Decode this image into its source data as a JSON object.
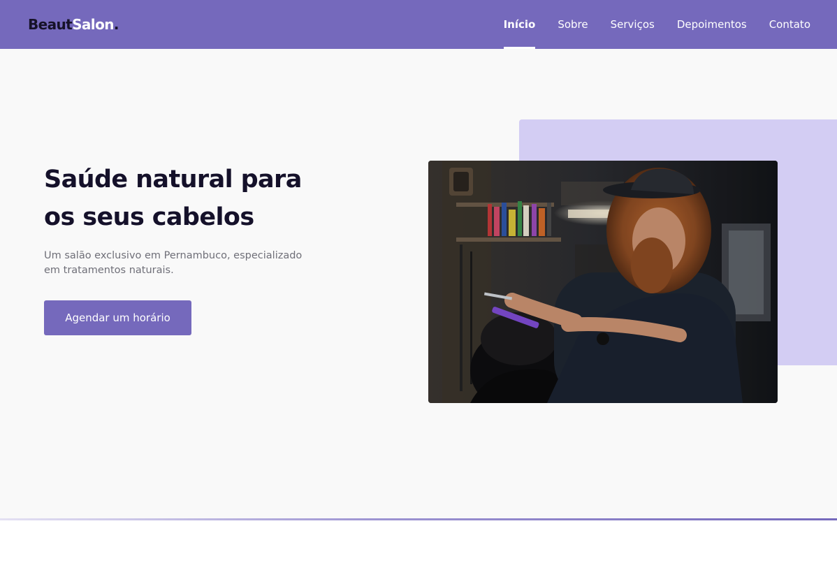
{
  "brand": {
    "logo_part1": "Beaut",
    "logo_part2": "Salon",
    "logo_part3": "."
  },
  "nav": {
    "items": [
      {
        "label": "Início",
        "active": true
      },
      {
        "label": "Sobre",
        "active": false
      },
      {
        "label": "Serviços",
        "active": false
      },
      {
        "label": "Depoimentos",
        "active": false
      },
      {
        "label": "Contato",
        "active": false
      }
    ]
  },
  "hero": {
    "title": "Saúde natural para os seus cabelos",
    "description": "Um salão exclusivo em Pernambuco, especializado em tratamentos naturais.",
    "cta_label": "Agendar um horário"
  },
  "colors": {
    "primary": "#7569bc",
    "accent_light": "#d3cdf3",
    "heading": "#15112a",
    "body_text": "#6f6f78",
    "background": "#f9f9f9"
  },
  "icons": {
    "hero_image": "barber-cutting-hair-photo"
  }
}
